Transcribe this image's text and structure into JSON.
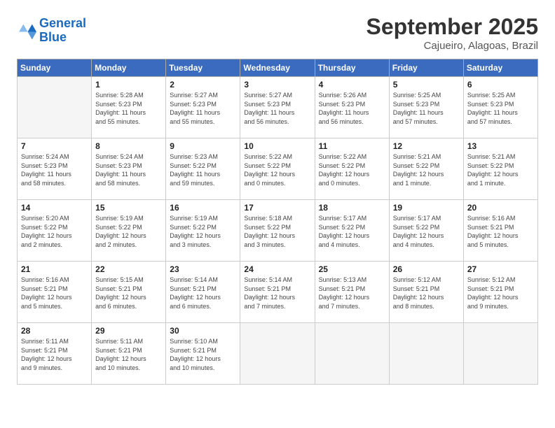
{
  "header": {
    "logo_general": "General",
    "logo_blue": "Blue",
    "month": "September 2025",
    "location": "Cajueiro, Alagoas, Brazil"
  },
  "weekdays": [
    "Sunday",
    "Monday",
    "Tuesday",
    "Wednesday",
    "Thursday",
    "Friday",
    "Saturday"
  ],
  "weeks": [
    [
      {
        "day": "",
        "info": ""
      },
      {
        "day": "1",
        "info": "Sunrise: 5:28 AM\nSunset: 5:23 PM\nDaylight: 11 hours\nand 55 minutes."
      },
      {
        "day": "2",
        "info": "Sunrise: 5:27 AM\nSunset: 5:23 PM\nDaylight: 11 hours\nand 55 minutes."
      },
      {
        "day": "3",
        "info": "Sunrise: 5:27 AM\nSunset: 5:23 PM\nDaylight: 11 hours\nand 56 minutes."
      },
      {
        "day": "4",
        "info": "Sunrise: 5:26 AM\nSunset: 5:23 PM\nDaylight: 11 hours\nand 56 minutes."
      },
      {
        "day": "5",
        "info": "Sunrise: 5:25 AM\nSunset: 5:23 PM\nDaylight: 11 hours\nand 57 minutes."
      },
      {
        "day": "6",
        "info": "Sunrise: 5:25 AM\nSunset: 5:23 PM\nDaylight: 11 hours\nand 57 minutes."
      }
    ],
    [
      {
        "day": "7",
        "info": "Sunrise: 5:24 AM\nSunset: 5:23 PM\nDaylight: 11 hours\nand 58 minutes."
      },
      {
        "day": "8",
        "info": "Sunrise: 5:24 AM\nSunset: 5:23 PM\nDaylight: 11 hours\nand 58 minutes."
      },
      {
        "day": "9",
        "info": "Sunrise: 5:23 AM\nSunset: 5:22 PM\nDaylight: 11 hours\nand 59 minutes."
      },
      {
        "day": "10",
        "info": "Sunrise: 5:22 AM\nSunset: 5:22 PM\nDaylight: 12 hours\nand 0 minutes."
      },
      {
        "day": "11",
        "info": "Sunrise: 5:22 AM\nSunset: 5:22 PM\nDaylight: 12 hours\nand 0 minutes."
      },
      {
        "day": "12",
        "info": "Sunrise: 5:21 AM\nSunset: 5:22 PM\nDaylight: 12 hours\nand 1 minute."
      },
      {
        "day": "13",
        "info": "Sunrise: 5:21 AM\nSunset: 5:22 PM\nDaylight: 12 hours\nand 1 minute."
      }
    ],
    [
      {
        "day": "14",
        "info": "Sunrise: 5:20 AM\nSunset: 5:22 PM\nDaylight: 12 hours\nand 2 minutes."
      },
      {
        "day": "15",
        "info": "Sunrise: 5:19 AM\nSunset: 5:22 PM\nDaylight: 12 hours\nand 2 minutes."
      },
      {
        "day": "16",
        "info": "Sunrise: 5:19 AM\nSunset: 5:22 PM\nDaylight: 12 hours\nand 3 minutes."
      },
      {
        "day": "17",
        "info": "Sunrise: 5:18 AM\nSunset: 5:22 PM\nDaylight: 12 hours\nand 3 minutes."
      },
      {
        "day": "18",
        "info": "Sunrise: 5:17 AM\nSunset: 5:22 PM\nDaylight: 12 hours\nand 4 minutes."
      },
      {
        "day": "19",
        "info": "Sunrise: 5:17 AM\nSunset: 5:22 PM\nDaylight: 12 hours\nand 4 minutes."
      },
      {
        "day": "20",
        "info": "Sunrise: 5:16 AM\nSunset: 5:21 PM\nDaylight: 12 hours\nand 5 minutes."
      }
    ],
    [
      {
        "day": "21",
        "info": "Sunrise: 5:16 AM\nSunset: 5:21 PM\nDaylight: 12 hours\nand 5 minutes."
      },
      {
        "day": "22",
        "info": "Sunrise: 5:15 AM\nSunset: 5:21 PM\nDaylight: 12 hours\nand 6 minutes."
      },
      {
        "day": "23",
        "info": "Sunrise: 5:14 AM\nSunset: 5:21 PM\nDaylight: 12 hours\nand 6 minutes."
      },
      {
        "day": "24",
        "info": "Sunrise: 5:14 AM\nSunset: 5:21 PM\nDaylight: 12 hours\nand 7 minutes."
      },
      {
        "day": "25",
        "info": "Sunrise: 5:13 AM\nSunset: 5:21 PM\nDaylight: 12 hours\nand 7 minutes."
      },
      {
        "day": "26",
        "info": "Sunrise: 5:12 AM\nSunset: 5:21 PM\nDaylight: 12 hours\nand 8 minutes."
      },
      {
        "day": "27",
        "info": "Sunrise: 5:12 AM\nSunset: 5:21 PM\nDaylight: 12 hours\nand 9 minutes."
      }
    ],
    [
      {
        "day": "28",
        "info": "Sunrise: 5:11 AM\nSunset: 5:21 PM\nDaylight: 12 hours\nand 9 minutes."
      },
      {
        "day": "29",
        "info": "Sunrise: 5:11 AM\nSunset: 5:21 PM\nDaylight: 12 hours\nand 10 minutes."
      },
      {
        "day": "30",
        "info": "Sunrise: 5:10 AM\nSunset: 5:21 PM\nDaylight: 12 hours\nand 10 minutes."
      },
      {
        "day": "",
        "info": ""
      },
      {
        "day": "",
        "info": ""
      },
      {
        "day": "",
        "info": ""
      },
      {
        "day": "",
        "info": ""
      }
    ]
  ]
}
